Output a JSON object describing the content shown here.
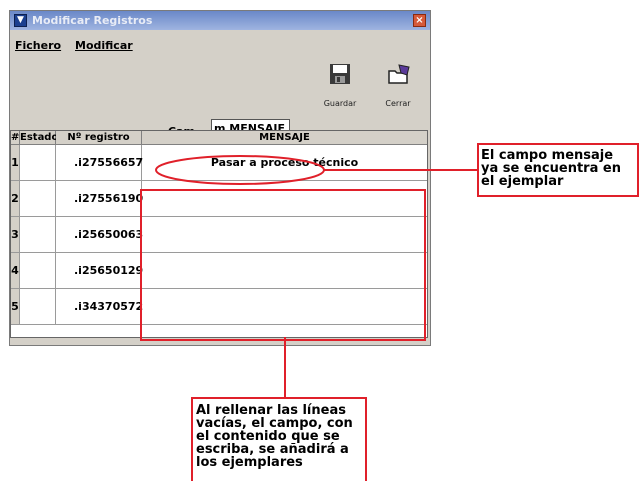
{
  "window": {
    "title": "Modificar Registros",
    "close": "×"
  },
  "menu": {
    "fichero": "Fichero",
    "modificar": "Modificar"
  },
  "toolbar": {
    "guardar": "Guardar",
    "cerrar": "Cerrar"
  },
  "campo": {
    "label": "Cam...",
    "value": "m MENSAJE"
  },
  "table": {
    "headers": [
      "#",
      "Estado",
      "Nº registro",
      "MENSAJE"
    ],
    "rows": [
      {
        "num": "1",
        "estado": "",
        "registro": ".i27556657",
        "mensaje": "Pasar a proceso técnico"
      },
      {
        "num": "2",
        "estado": "",
        "registro": ".i27556190",
        "mensaje": ""
      },
      {
        "num": "3",
        "estado": "",
        "registro": ".i25650063",
        "mensaje": ""
      },
      {
        "num": "4",
        "estado": "",
        "registro": ".i25650129",
        "mensaje": ""
      },
      {
        "num": "5",
        "estado": "",
        "registro": ".i34370572",
        "mensaje": ""
      }
    ]
  },
  "annotations": {
    "right": "El campo mensaje\nya se encuentra en\nel ejemplar",
    "bottom": "Al rellenar las líneas\nvacías, el campo, con\nel contenido que se\nescriba, se añadirá a\nlos ejemplares"
  },
  "colors": {
    "annotation": "#e0202a",
    "titlebar": "#6a88c8"
  }
}
